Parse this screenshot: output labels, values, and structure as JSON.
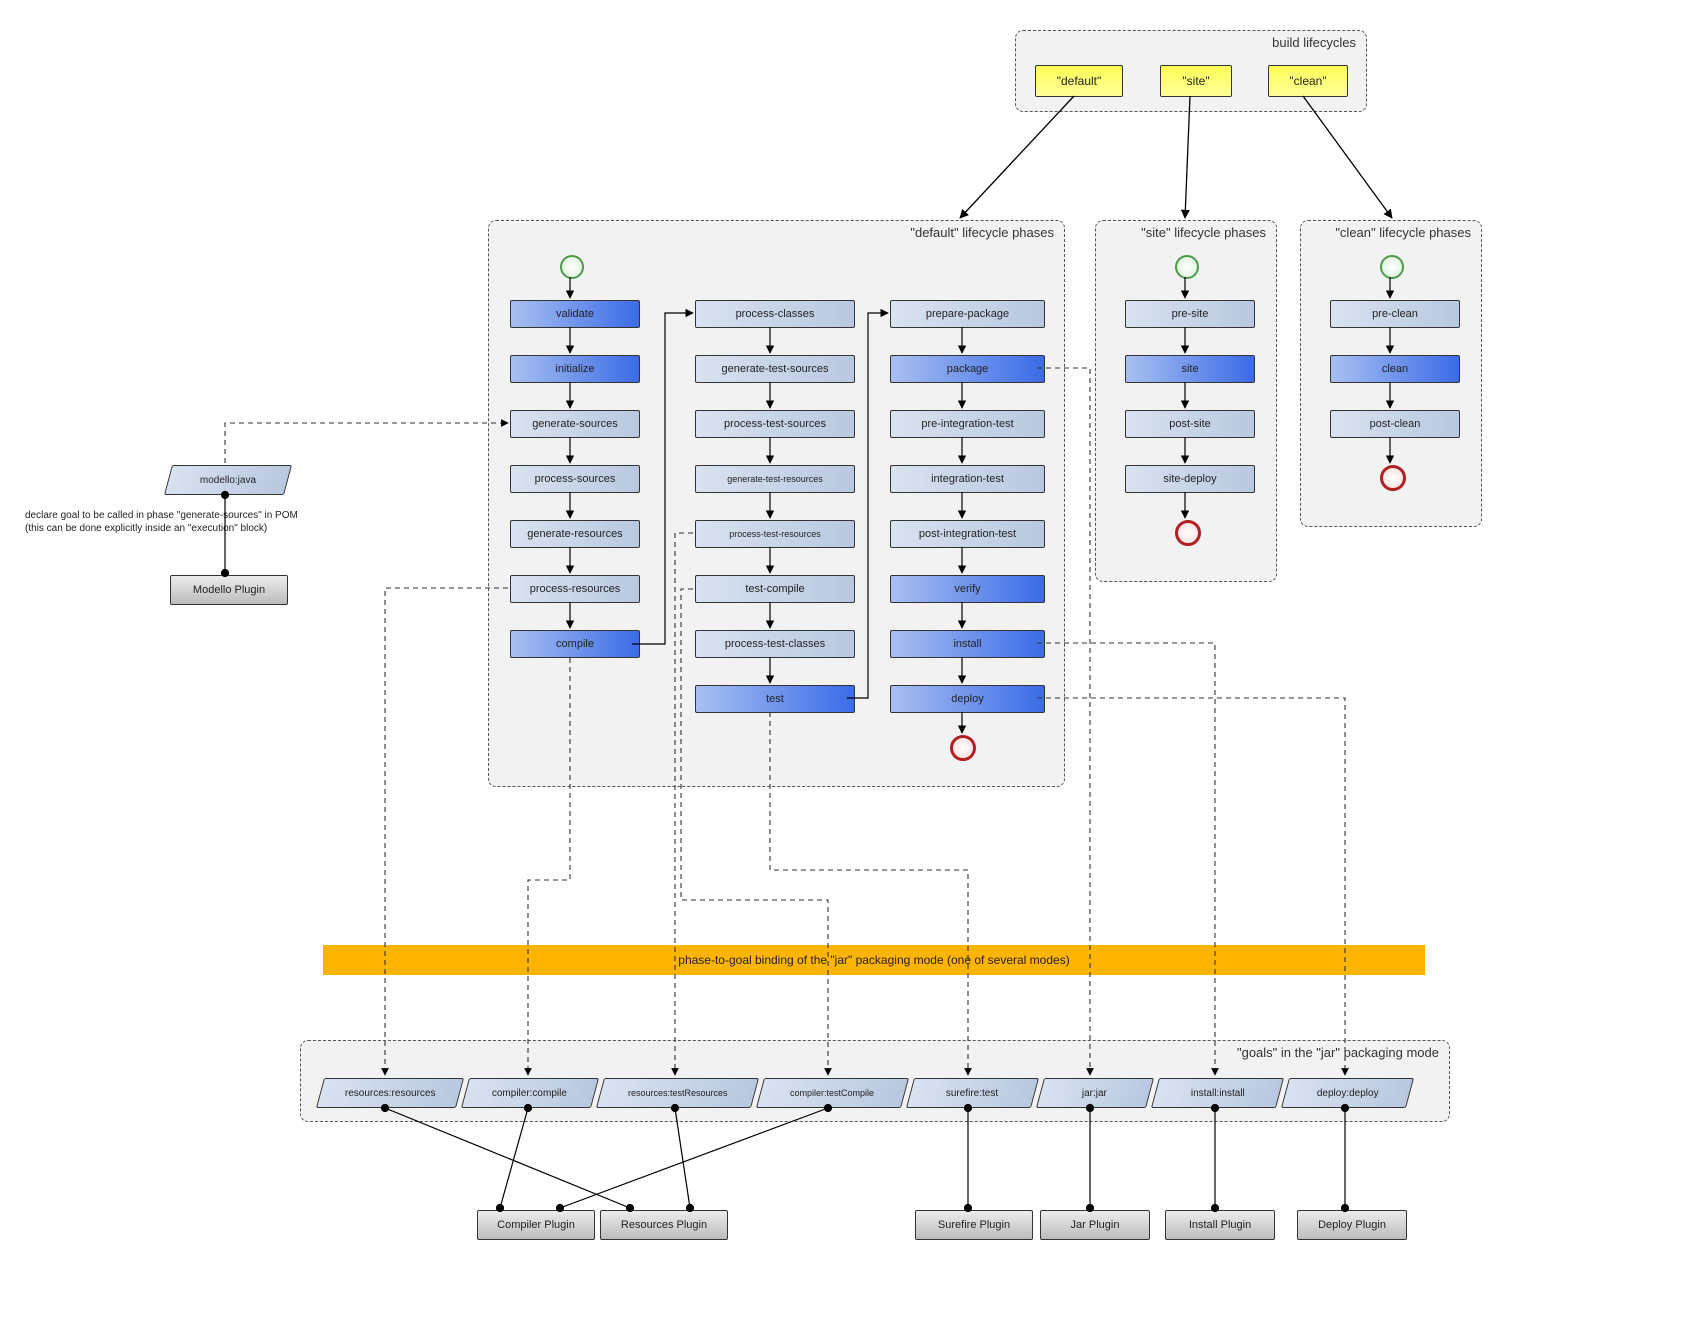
{
  "lifecycles_container": {
    "title": "build lifecycles"
  },
  "lifecycles": {
    "default": "\"default\"",
    "site": "\"site\"",
    "clean": "\"clean\""
  },
  "default_container": {
    "title": "\"default\" lifecycle phases"
  },
  "site_container": {
    "title": "\"site\" lifecycle phases"
  },
  "clean_container": {
    "title": "\"clean\" lifecycle phases"
  },
  "goals_container": {
    "title": "\"goals\" in the \"jar\" packaging mode"
  },
  "phases": {
    "default": {
      "col1": [
        "validate",
        "initialize",
        "generate-sources",
        "process-sources",
        "generate-resources",
        "process-resources",
        "compile"
      ],
      "col2": [
        "process-classes",
        "generate-test-sources",
        "process-test-sources",
        "generate-test-resources",
        "process-test-resources",
        "test-compile",
        "process-test-classes",
        "test"
      ],
      "col3": [
        "prepare-package",
        "package",
        "pre-integration-test",
        "integration-test",
        "post-integration-test",
        "verify",
        "install",
        "deploy"
      ]
    },
    "site": [
      "pre-site",
      "site",
      "post-site",
      "site-deploy"
    ],
    "clean": [
      "pre-clean",
      "clean",
      "post-clean"
    ]
  },
  "strong_phases": [
    "validate",
    "initialize",
    "compile",
    "test",
    "package",
    "verify",
    "install",
    "deploy",
    "site",
    "clean"
  ],
  "modello": {
    "goal": "modello:java",
    "plugin": "Modello Plugin",
    "caption_line1": "declare goal to be called in phase \"generate-sources\" in POM",
    "caption_line2": "(this can be done explicitly inside an \"execution\" block)"
  },
  "banner": "phase-to-goal binding of the \"jar\" packaging mode (one of several modes)",
  "goals": [
    "resources:resources",
    "compiler:compile",
    "resources:testResources",
    "compiler:testCompile",
    "surefire:test",
    "jar:jar",
    "install:install",
    "deploy:deploy"
  ],
  "plugins": {
    "compiler": "Compiler Plugin",
    "resources": "Resources Plugin",
    "surefire": "Surefire Plugin",
    "jar": "Jar Plugin",
    "install": "Install Plugin",
    "deploy": "Deploy Plugin"
  },
  "chart_data": {
    "type": "diagram",
    "title": "Maven build lifecycles, phases, goals and plugin bindings",
    "lifecycles": [
      {
        "name": "default",
        "phases": [
          "validate",
          "initialize",
          "generate-sources",
          "process-sources",
          "generate-resources",
          "process-resources",
          "compile",
          "process-classes",
          "generate-test-sources",
          "process-test-sources",
          "generate-test-resources",
          "process-test-resources",
          "test-compile",
          "process-test-classes",
          "test",
          "prepare-package",
          "package",
          "pre-integration-test",
          "integration-test",
          "post-integration-test",
          "verify",
          "install",
          "deploy"
        ]
      },
      {
        "name": "site",
        "phases": [
          "pre-site",
          "site",
          "post-site",
          "site-deploy"
        ]
      },
      {
        "name": "clean",
        "phases": [
          "pre-clean",
          "clean",
          "post-clean"
        ]
      }
    ],
    "jar_packaging_bindings": [
      {
        "phase": "process-resources",
        "goal": "resources:resources",
        "plugin": "Resources Plugin"
      },
      {
        "phase": "compile",
        "goal": "compiler:compile",
        "plugin": "Compiler Plugin"
      },
      {
        "phase": "process-test-resources",
        "goal": "resources:testResources",
        "plugin": "Resources Plugin"
      },
      {
        "phase": "test-compile",
        "goal": "compiler:testCompile",
        "plugin": "Compiler Plugin"
      },
      {
        "phase": "test",
        "goal": "surefire:test",
        "plugin": "Surefire Plugin"
      },
      {
        "phase": "package",
        "goal": "jar:jar",
        "plugin": "Jar Plugin"
      },
      {
        "phase": "install",
        "goal": "install:install",
        "plugin": "Install Plugin"
      },
      {
        "phase": "deploy",
        "goal": "deploy:deploy",
        "plugin": "Deploy Plugin"
      }
    ],
    "extra_binding_example": {
      "phase": "generate-sources",
      "goal": "modello:java",
      "plugin": "Modello Plugin",
      "note": "declared in POM execution block"
    }
  }
}
